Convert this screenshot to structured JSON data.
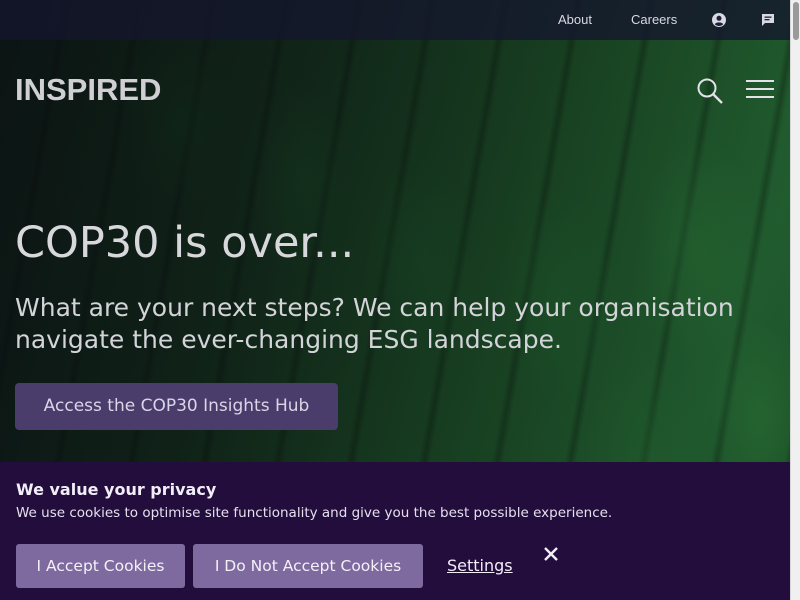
{
  "topbar": {
    "links": [
      {
        "label": "About"
      },
      {
        "label": "Careers"
      }
    ],
    "icons": {
      "account": "user-circle-icon",
      "chat": "chat-bubble-icon"
    }
  },
  "header": {
    "logo": "INSPIRED",
    "search_icon": "search-icon",
    "menu_icon": "hamburger-menu-icon"
  },
  "hero": {
    "title": "COP30 is over...",
    "subtitle": "What are your next steps? We can help your organisation navigate the ever-changing ESG landscape.",
    "cta_label": "Access the COP30 Insights Hub"
  },
  "cookie_banner": {
    "title": "We value your privacy",
    "text": "We use cookies to optimise site functionality and give you the best possible experience.",
    "accept_label": "I Accept Cookies",
    "decline_label": "I Do Not Accept Cookies",
    "settings_label": "Settings",
    "close_icon": "close-icon"
  },
  "colors": {
    "banner_bg": "#230d3c",
    "banner_button": "#7e6a9e",
    "cta_button": "#4b3d6b",
    "topbar_bg": "#14162d"
  }
}
